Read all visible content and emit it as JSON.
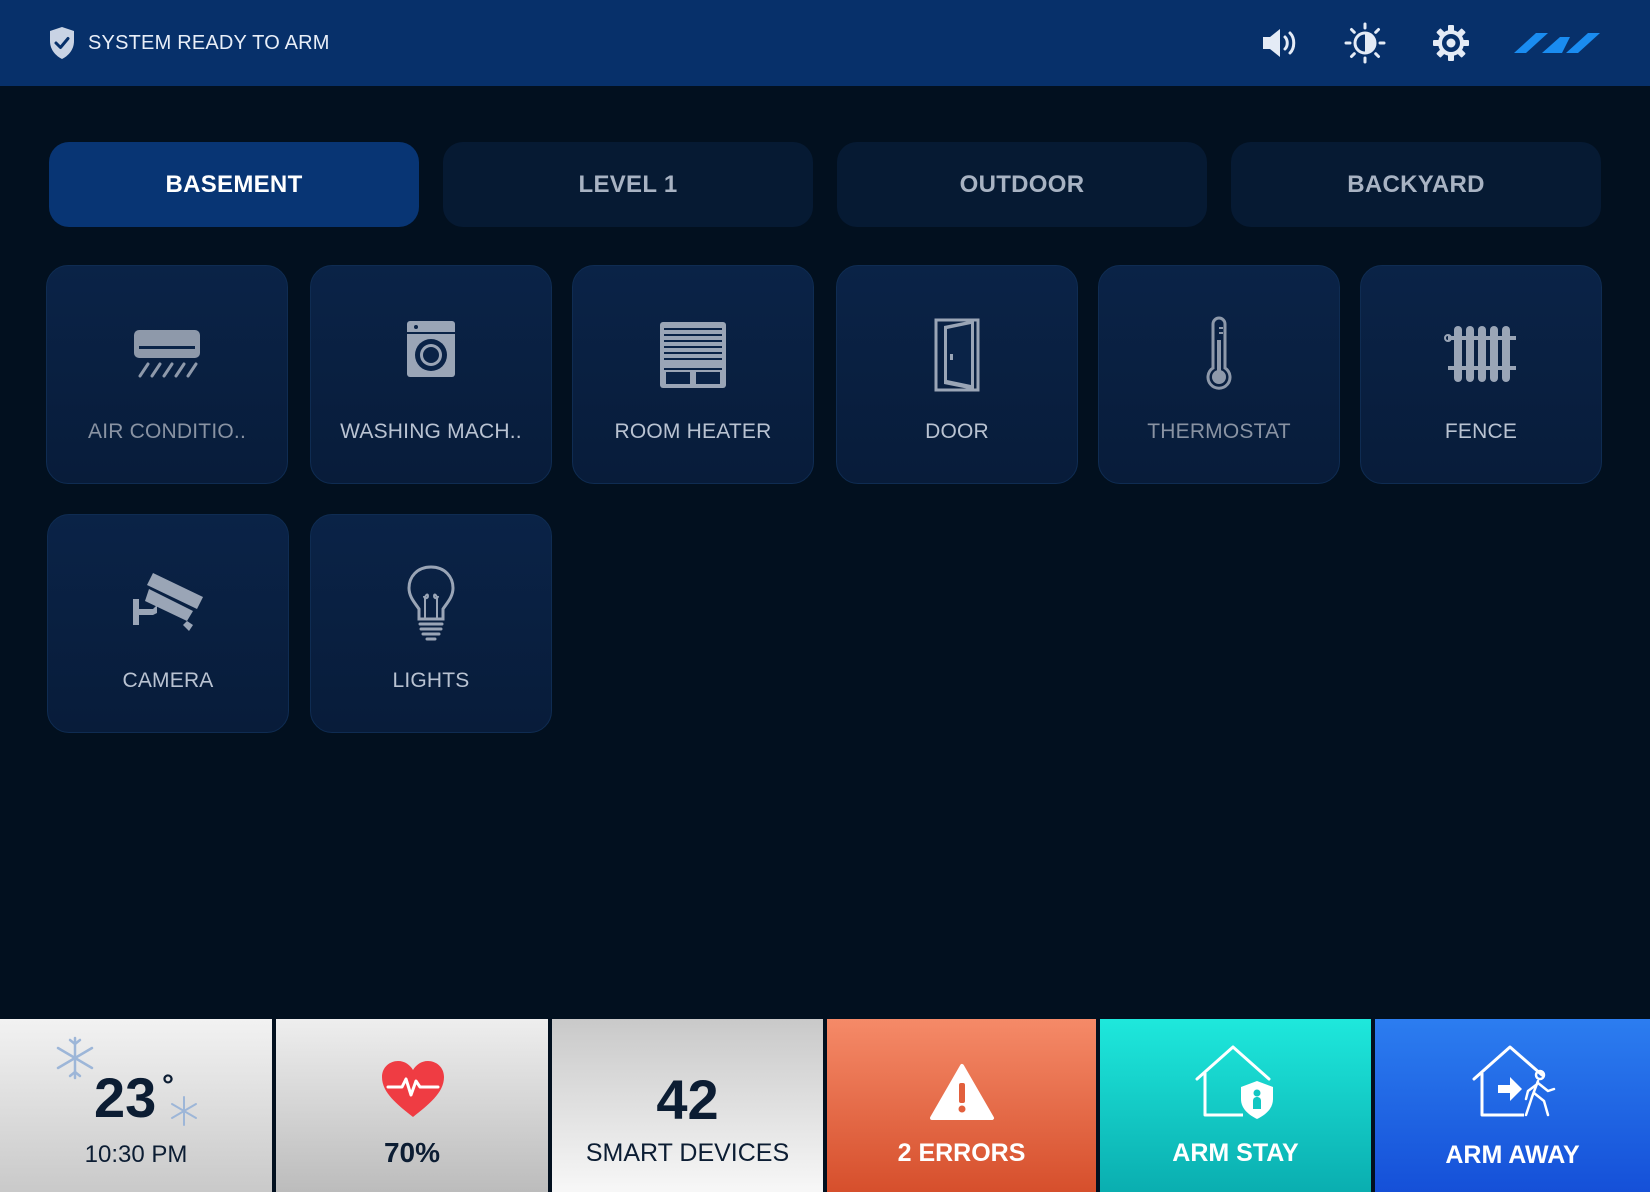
{
  "header": {
    "status_text": "SYSTEM READY TO ARM",
    "icons": [
      "shield-check-icon",
      "volume-icon",
      "brightness-icon",
      "gear-icon",
      "brand-logo-icon"
    ]
  },
  "tabs": [
    {
      "label": "BASEMENT",
      "active": true
    },
    {
      "label": "LEVEL 1",
      "active": false
    },
    {
      "label": "OUTDOOR",
      "active": false
    },
    {
      "label": "BACKYARD",
      "active": false
    }
  ],
  "devices": [
    {
      "label": "AIR CONDITIO..",
      "icon": "air-conditioner-icon"
    },
    {
      "label": "WASHING MACH..",
      "icon": "washing-machine-icon"
    },
    {
      "label": "ROOM HEATER",
      "icon": "room-heater-icon"
    },
    {
      "label": "DOOR",
      "icon": "door-icon"
    },
    {
      "label": "THERMOSTAT",
      "icon": "thermometer-icon"
    },
    {
      "label": "FENCE",
      "icon": "fence-icon"
    },
    {
      "label": "CAMERA",
      "icon": "camera-icon"
    },
    {
      "label": "LIGHTS",
      "icon": "light-bulb-icon"
    }
  ],
  "bottom": {
    "weather": {
      "temperature": "23",
      "degree": "°",
      "time": "10:30 PM"
    },
    "health": {
      "percent": "70%"
    },
    "devices": {
      "count": "42",
      "label": "SMART DEVICES"
    },
    "errors": {
      "label": "2 ERRORS"
    },
    "arm_stay": {
      "label": "ARM STAY"
    },
    "arm_away": {
      "label": "ARM AWAY"
    }
  },
  "colors": {
    "header_bg": "#07306a",
    "page_bg": "#02101f",
    "tab_active": "#083574",
    "errors": "#e56a47",
    "arm_stay": "#12cfcb",
    "arm_away": "#1f64e4"
  }
}
